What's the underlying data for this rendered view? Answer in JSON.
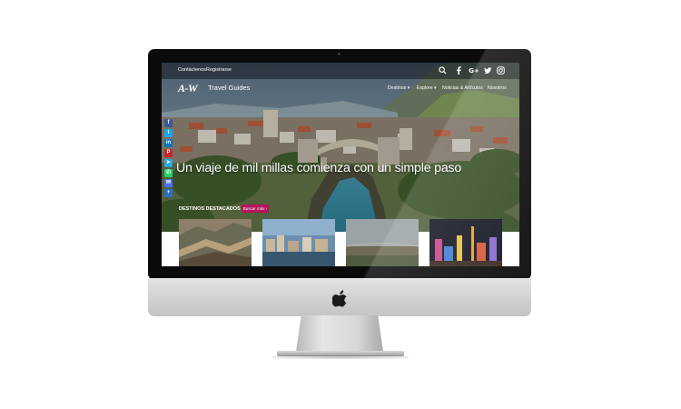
{
  "topbar": {
    "links": [
      "Contáctenos",
      "Registrarse"
    ],
    "icons": [
      "search-icon",
      "facebook-icon",
      "google-plus-icon",
      "twitter-icon",
      "instagram-icon"
    ]
  },
  "brand": {
    "mark": "A-W",
    "name": "Travel Guides"
  },
  "nav": {
    "items": [
      "Destinos",
      "Explore",
      "Noticias & Artículos",
      "Nosotros"
    ]
  },
  "share_bar": {
    "icons": [
      "facebook-icon",
      "twitter-icon",
      "linkedin-icon",
      "pinterest-icon",
      "telegram-icon",
      "whatsapp-icon",
      "email-icon",
      "more-share-icon"
    ],
    "colors": [
      "#3b5998",
      "#1da1f2",
      "#0077b5",
      "#cb2027",
      "#2ca5e0",
      "#25d366",
      "#4c6ef5",
      "#2b6dc4"
    ]
  },
  "hero": {
    "headline": "Un viaje de mil millas comienza con un simple paso"
  },
  "featured": {
    "label": "DESTINOS DESTACADOS",
    "see_more": "Buscar más ›"
  },
  "cards": [
    {
      "image": "great-wall"
    },
    {
      "image": "city-waterfront"
    },
    {
      "image": "plain-landscape"
    },
    {
      "image": "las-vegas-night"
    }
  ],
  "colors": {
    "accent": "#b4155a",
    "bezel": "#0b0b0b",
    "aluminum": "#d0d0d0"
  }
}
